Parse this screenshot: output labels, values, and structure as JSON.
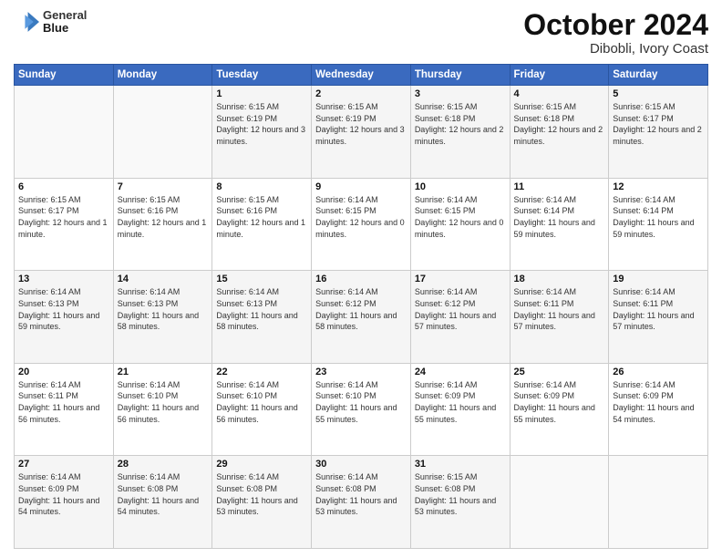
{
  "header": {
    "logo_line1": "General",
    "logo_line2": "Blue",
    "title": "October 2024",
    "subtitle": "Dibobli, Ivory Coast"
  },
  "days_of_week": [
    "Sunday",
    "Monday",
    "Tuesday",
    "Wednesday",
    "Thursday",
    "Friday",
    "Saturday"
  ],
  "weeks": [
    [
      {
        "day": "",
        "info": ""
      },
      {
        "day": "",
        "info": ""
      },
      {
        "day": "1",
        "info": "Sunrise: 6:15 AM\nSunset: 6:19 PM\nDaylight: 12 hours and 3 minutes."
      },
      {
        "day": "2",
        "info": "Sunrise: 6:15 AM\nSunset: 6:19 PM\nDaylight: 12 hours and 3 minutes."
      },
      {
        "day": "3",
        "info": "Sunrise: 6:15 AM\nSunset: 6:18 PM\nDaylight: 12 hours and 2 minutes."
      },
      {
        "day": "4",
        "info": "Sunrise: 6:15 AM\nSunset: 6:18 PM\nDaylight: 12 hours and 2 minutes."
      },
      {
        "day": "5",
        "info": "Sunrise: 6:15 AM\nSunset: 6:17 PM\nDaylight: 12 hours and 2 minutes."
      }
    ],
    [
      {
        "day": "6",
        "info": "Sunrise: 6:15 AM\nSunset: 6:17 PM\nDaylight: 12 hours and 1 minute."
      },
      {
        "day": "7",
        "info": "Sunrise: 6:15 AM\nSunset: 6:16 PM\nDaylight: 12 hours and 1 minute."
      },
      {
        "day": "8",
        "info": "Sunrise: 6:15 AM\nSunset: 6:16 PM\nDaylight: 12 hours and 1 minute."
      },
      {
        "day": "9",
        "info": "Sunrise: 6:14 AM\nSunset: 6:15 PM\nDaylight: 12 hours and 0 minutes."
      },
      {
        "day": "10",
        "info": "Sunrise: 6:14 AM\nSunset: 6:15 PM\nDaylight: 12 hours and 0 minutes."
      },
      {
        "day": "11",
        "info": "Sunrise: 6:14 AM\nSunset: 6:14 PM\nDaylight: 11 hours and 59 minutes."
      },
      {
        "day": "12",
        "info": "Sunrise: 6:14 AM\nSunset: 6:14 PM\nDaylight: 11 hours and 59 minutes."
      }
    ],
    [
      {
        "day": "13",
        "info": "Sunrise: 6:14 AM\nSunset: 6:13 PM\nDaylight: 11 hours and 59 minutes."
      },
      {
        "day": "14",
        "info": "Sunrise: 6:14 AM\nSunset: 6:13 PM\nDaylight: 11 hours and 58 minutes."
      },
      {
        "day": "15",
        "info": "Sunrise: 6:14 AM\nSunset: 6:13 PM\nDaylight: 11 hours and 58 minutes."
      },
      {
        "day": "16",
        "info": "Sunrise: 6:14 AM\nSunset: 6:12 PM\nDaylight: 11 hours and 58 minutes."
      },
      {
        "day": "17",
        "info": "Sunrise: 6:14 AM\nSunset: 6:12 PM\nDaylight: 11 hours and 57 minutes."
      },
      {
        "day": "18",
        "info": "Sunrise: 6:14 AM\nSunset: 6:11 PM\nDaylight: 11 hours and 57 minutes."
      },
      {
        "day": "19",
        "info": "Sunrise: 6:14 AM\nSunset: 6:11 PM\nDaylight: 11 hours and 57 minutes."
      }
    ],
    [
      {
        "day": "20",
        "info": "Sunrise: 6:14 AM\nSunset: 6:11 PM\nDaylight: 11 hours and 56 minutes."
      },
      {
        "day": "21",
        "info": "Sunrise: 6:14 AM\nSunset: 6:10 PM\nDaylight: 11 hours and 56 minutes."
      },
      {
        "day": "22",
        "info": "Sunrise: 6:14 AM\nSunset: 6:10 PM\nDaylight: 11 hours and 56 minutes."
      },
      {
        "day": "23",
        "info": "Sunrise: 6:14 AM\nSunset: 6:10 PM\nDaylight: 11 hours and 55 minutes."
      },
      {
        "day": "24",
        "info": "Sunrise: 6:14 AM\nSunset: 6:09 PM\nDaylight: 11 hours and 55 minutes."
      },
      {
        "day": "25",
        "info": "Sunrise: 6:14 AM\nSunset: 6:09 PM\nDaylight: 11 hours and 55 minutes."
      },
      {
        "day": "26",
        "info": "Sunrise: 6:14 AM\nSunset: 6:09 PM\nDaylight: 11 hours and 54 minutes."
      }
    ],
    [
      {
        "day": "27",
        "info": "Sunrise: 6:14 AM\nSunset: 6:09 PM\nDaylight: 11 hours and 54 minutes."
      },
      {
        "day": "28",
        "info": "Sunrise: 6:14 AM\nSunset: 6:08 PM\nDaylight: 11 hours and 54 minutes."
      },
      {
        "day": "29",
        "info": "Sunrise: 6:14 AM\nSunset: 6:08 PM\nDaylight: 11 hours and 53 minutes."
      },
      {
        "day": "30",
        "info": "Sunrise: 6:14 AM\nSunset: 6:08 PM\nDaylight: 11 hours and 53 minutes."
      },
      {
        "day": "31",
        "info": "Sunrise: 6:15 AM\nSunset: 6:08 PM\nDaylight: 11 hours and 53 minutes."
      },
      {
        "day": "",
        "info": ""
      },
      {
        "day": "",
        "info": ""
      }
    ]
  ]
}
